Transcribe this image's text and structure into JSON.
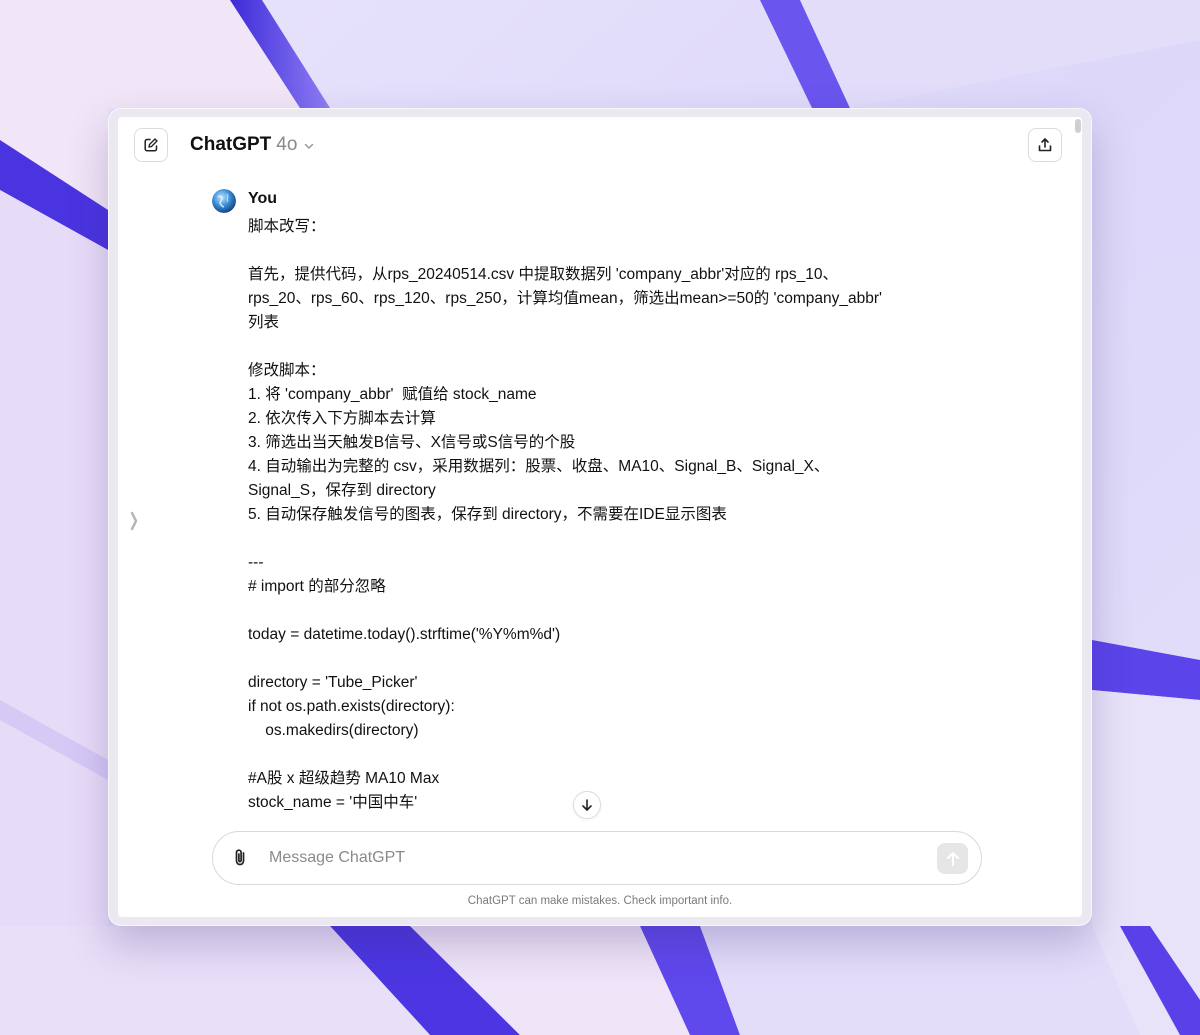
{
  "header": {
    "model_name": "ChatGPT",
    "model_version": "4o"
  },
  "message": {
    "author": "You",
    "lines": [
      "脚本改写：",
      "",
      "首先，提供代码，从rps_20240514.csv 中提取数据列 'company_abbr'对应的 rps_10、",
      "rps_20、rps_60、rps_120、rps_250，计算均值mean，筛选出mean>=50的 'company_abbr'",
      "列表",
      "",
      "修改脚本：",
      "1. 将 'company_abbr'  赋值给 stock_name",
      "2. 依次传入下方脚本去计算",
      "3. 筛选出当天触发B信号、X信号或S信号的个股",
      "4. 自动输出为完整的 csv，采用数据列：股票、收盘、MA10、Signal_B、Signal_X、",
      "Signal_S，保存到 directory",
      "5. 自动保存触发信号的图表，保存到 directory，不需要在IDE显示图表",
      "",
      "---",
      "# import 的部分忽略",
      "",
      "today = datetime.today().strftime('%Y%m%d')",
      "",
      "directory = 'Tube_Picker'",
      "if not os.path.exists(directory):",
      "    os.makedirs(directory)",
      "",
      "#A股 x 超级趋势 MA10 Max",
      "stock_name = '中国中车'"
    ]
  },
  "composer": {
    "placeholder": "Message ChatGPT"
  },
  "footer": {
    "disclaimer": "ChatGPT can make mistakes. Check important info."
  },
  "colors": {
    "wallpaper_accent": "#5a3cf0",
    "wallpaper_light": "#e8e2fb",
    "send_button_bg": "#e6e6e6"
  }
}
